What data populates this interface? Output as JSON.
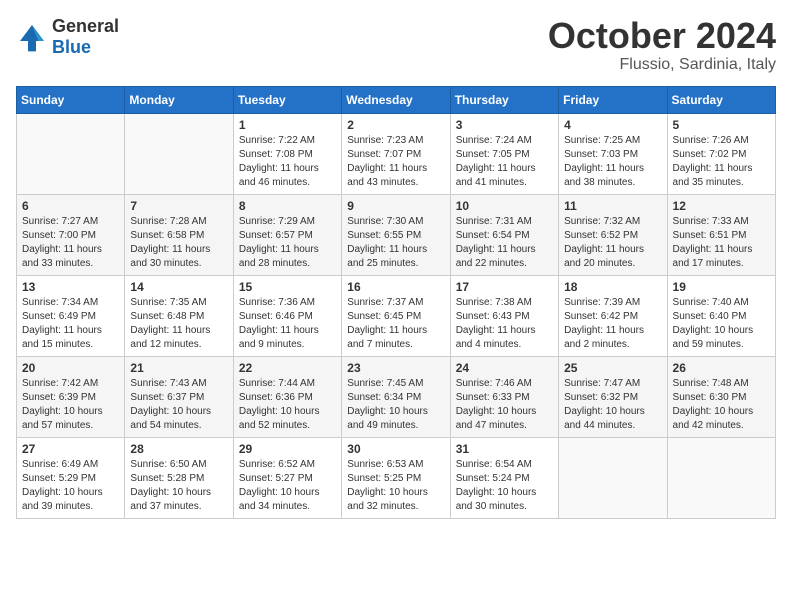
{
  "logo": {
    "general": "General",
    "blue": "Blue"
  },
  "title": "October 2024",
  "location": "Flussio, Sardinia, Italy",
  "days_of_week": [
    "Sunday",
    "Monday",
    "Tuesday",
    "Wednesday",
    "Thursday",
    "Friday",
    "Saturday"
  ],
  "weeks": [
    [
      {
        "day": null,
        "info": null
      },
      {
        "day": null,
        "info": null
      },
      {
        "day": "1",
        "info": "Sunrise: 7:22 AM\nSunset: 7:08 PM\nDaylight: 11 hours and 46 minutes."
      },
      {
        "day": "2",
        "info": "Sunrise: 7:23 AM\nSunset: 7:07 PM\nDaylight: 11 hours and 43 minutes."
      },
      {
        "day": "3",
        "info": "Sunrise: 7:24 AM\nSunset: 7:05 PM\nDaylight: 11 hours and 41 minutes."
      },
      {
        "day": "4",
        "info": "Sunrise: 7:25 AM\nSunset: 7:03 PM\nDaylight: 11 hours and 38 minutes."
      },
      {
        "day": "5",
        "info": "Sunrise: 7:26 AM\nSunset: 7:02 PM\nDaylight: 11 hours and 35 minutes."
      }
    ],
    [
      {
        "day": "6",
        "info": "Sunrise: 7:27 AM\nSunset: 7:00 PM\nDaylight: 11 hours and 33 minutes."
      },
      {
        "day": "7",
        "info": "Sunrise: 7:28 AM\nSunset: 6:58 PM\nDaylight: 11 hours and 30 minutes."
      },
      {
        "day": "8",
        "info": "Sunrise: 7:29 AM\nSunset: 6:57 PM\nDaylight: 11 hours and 28 minutes."
      },
      {
        "day": "9",
        "info": "Sunrise: 7:30 AM\nSunset: 6:55 PM\nDaylight: 11 hours and 25 minutes."
      },
      {
        "day": "10",
        "info": "Sunrise: 7:31 AM\nSunset: 6:54 PM\nDaylight: 11 hours and 22 minutes."
      },
      {
        "day": "11",
        "info": "Sunrise: 7:32 AM\nSunset: 6:52 PM\nDaylight: 11 hours and 20 minutes."
      },
      {
        "day": "12",
        "info": "Sunrise: 7:33 AM\nSunset: 6:51 PM\nDaylight: 11 hours and 17 minutes."
      }
    ],
    [
      {
        "day": "13",
        "info": "Sunrise: 7:34 AM\nSunset: 6:49 PM\nDaylight: 11 hours and 15 minutes."
      },
      {
        "day": "14",
        "info": "Sunrise: 7:35 AM\nSunset: 6:48 PM\nDaylight: 11 hours and 12 minutes."
      },
      {
        "day": "15",
        "info": "Sunrise: 7:36 AM\nSunset: 6:46 PM\nDaylight: 11 hours and 9 minutes."
      },
      {
        "day": "16",
        "info": "Sunrise: 7:37 AM\nSunset: 6:45 PM\nDaylight: 11 hours and 7 minutes."
      },
      {
        "day": "17",
        "info": "Sunrise: 7:38 AM\nSunset: 6:43 PM\nDaylight: 11 hours and 4 minutes."
      },
      {
        "day": "18",
        "info": "Sunrise: 7:39 AM\nSunset: 6:42 PM\nDaylight: 11 hours and 2 minutes."
      },
      {
        "day": "19",
        "info": "Sunrise: 7:40 AM\nSunset: 6:40 PM\nDaylight: 10 hours and 59 minutes."
      }
    ],
    [
      {
        "day": "20",
        "info": "Sunrise: 7:42 AM\nSunset: 6:39 PM\nDaylight: 10 hours and 57 minutes."
      },
      {
        "day": "21",
        "info": "Sunrise: 7:43 AM\nSunset: 6:37 PM\nDaylight: 10 hours and 54 minutes."
      },
      {
        "day": "22",
        "info": "Sunrise: 7:44 AM\nSunset: 6:36 PM\nDaylight: 10 hours and 52 minutes."
      },
      {
        "day": "23",
        "info": "Sunrise: 7:45 AM\nSunset: 6:34 PM\nDaylight: 10 hours and 49 minutes."
      },
      {
        "day": "24",
        "info": "Sunrise: 7:46 AM\nSunset: 6:33 PM\nDaylight: 10 hours and 47 minutes."
      },
      {
        "day": "25",
        "info": "Sunrise: 7:47 AM\nSunset: 6:32 PM\nDaylight: 10 hours and 44 minutes."
      },
      {
        "day": "26",
        "info": "Sunrise: 7:48 AM\nSunset: 6:30 PM\nDaylight: 10 hours and 42 minutes."
      }
    ],
    [
      {
        "day": "27",
        "info": "Sunrise: 6:49 AM\nSunset: 5:29 PM\nDaylight: 10 hours and 39 minutes."
      },
      {
        "day": "28",
        "info": "Sunrise: 6:50 AM\nSunset: 5:28 PM\nDaylight: 10 hours and 37 minutes."
      },
      {
        "day": "29",
        "info": "Sunrise: 6:52 AM\nSunset: 5:27 PM\nDaylight: 10 hours and 34 minutes."
      },
      {
        "day": "30",
        "info": "Sunrise: 6:53 AM\nSunset: 5:25 PM\nDaylight: 10 hours and 32 minutes."
      },
      {
        "day": "31",
        "info": "Sunrise: 6:54 AM\nSunset: 5:24 PM\nDaylight: 10 hours and 30 minutes."
      },
      {
        "day": null,
        "info": null
      },
      {
        "day": null,
        "info": null
      }
    ]
  ]
}
